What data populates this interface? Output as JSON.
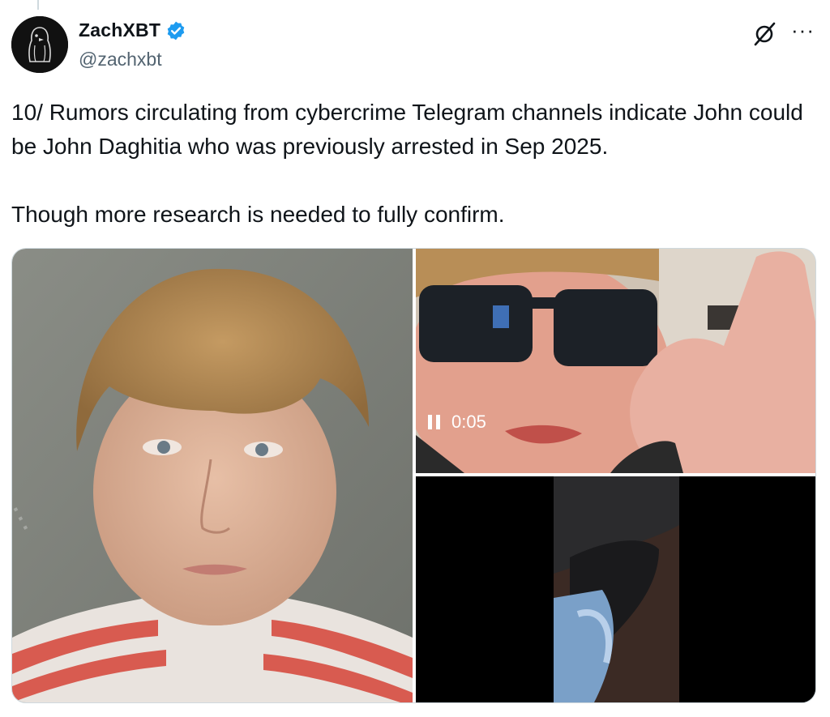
{
  "author": {
    "display_name": "ZachXBT",
    "handle": "@zachxbt",
    "verified": true,
    "verified_color": "#1d9bf0",
    "avatar": "penguin-avatar"
  },
  "actions": {
    "grok_icon": "grok-icon",
    "more_icon": "more-icon",
    "more_glyph": "···"
  },
  "tweet": {
    "line1": "10/ Rumors circulating from cybercrime Telegram channels indicate John could be John Daghitia who was previously arrested in Sep 2025.",
    "line2": "Though more research is needed to fully confirm."
  },
  "media": {
    "photos": [
      {
        "name": "mugshot-photo"
      },
      {
        "name": "sunglasses-selfie-photo"
      }
    ],
    "video": {
      "duration": "0:05",
      "state": "playing"
    }
  }
}
